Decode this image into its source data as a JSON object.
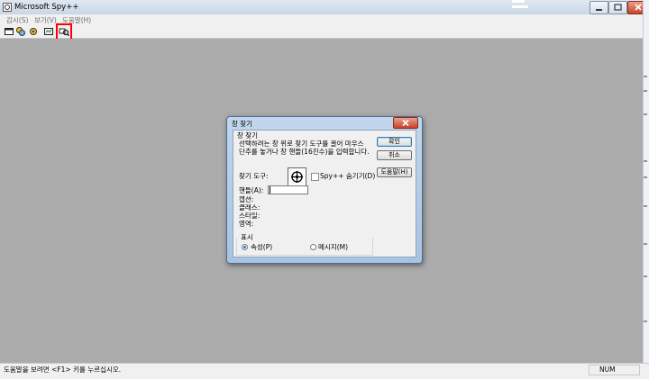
{
  "window": {
    "title": "Microsoft Spy++"
  },
  "menu": [
    "감시(S)",
    "보기(V)",
    "도움말(H)"
  ],
  "toolbar": {
    "buttons": [
      "windows-icon",
      "processes-icon",
      "threads-icon",
      "messages-icon",
      "find-window-icon"
    ],
    "highlighted": "find-window-icon",
    "highlight_color": "#ff0000"
  },
  "status": {
    "hint": "도움말을 보려면 <F1> 키를 누르십시오.",
    "num": "NUM"
  },
  "dialog": {
    "title": "창 찾기",
    "group_title": "창 찾기",
    "instructions_1": "선택하려는 창 위로 찾기 도구를 끌어 마우스",
    "instructions_2": "단추를 놓거나 창 핸들(16진수)을 입력합니다.",
    "find_tool_label": "찾기 도구:",
    "hide_spy_label": "Spy++ 숨기기(D)",
    "hide_spy_checked": false,
    "handle_label": "핸들(A):",
    "handle_value": "",
    "caption_label": "캡션:",
    "class_label": "클래스:",
    "style_label": "스타일:",
    "rect_label": "영역:",
    "show_label": "표시",
    "radio_properties": "속성(P)",
    "radio_messages": "메시지(M)",
    "selected_radio": "properties",
    "ok_button": "확인",
    "cancel_button": "취소",
    "help_button": "도움말(H)"
  },
  "colors": {
    "client_background": "#ababab",
    "dialog_frame": "#a9c3e0",
    "close_button": "#c7432a"
  }
}
